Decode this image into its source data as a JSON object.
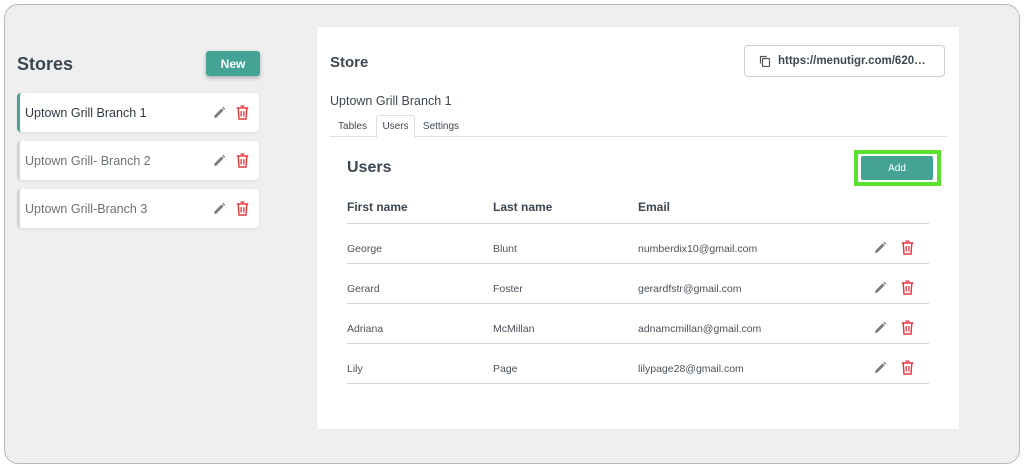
{
  "sidebar": {
    "title": "Stores",
    "new_label": "New",
    "stores": [
      {
        "name": "Uptown Grill Branch 1",
        "active": true
      },
      {
        "name": "Uptown Grill- Branch 2",
        "active": false
      },
      {
        "name": "Uptown Grill-Branch 3",
        "active": false
      }
    ]
  },
  "main": {
    "title": "Store",
    "url": "https://menutigr.com/620…",
    "store_name": "Uptown Grill Branch 1",
    "tabs": [
      {
        "label": "Tables",
        "active": false
      },
      {
        "label": "Users",
        "active": true
      },
      {
        "label": "Settings",
        "active": false
      }
    ],
    "users": {
      "title": "Users",
      "add_label": "Add",
      "columns": [
        "First name",
        "Last name",
        "Email"
      ],
      "rows": [
        {
          "first": "George",
          "last": "Blunt",
          "email": "numberdix10@gmail.com"
        },
        {
          "first": "Gerard",
          "last": "Foster",
          "email": "gerardfstr@gmail.com"
        },
        {
          "first": "Adriana",
          "last": "McMillan",
          "email": "adnamcmillan@gmail.com"
        },
        {
          "first": "Lily",
          "last": "Page",
          "email": "lilypage28@gmail.com"
        }
      ]
    }
  },
  "colors": {
    "accent": "#44a394",
    "delete": "#e0393e",
    "edit": "#7c7c7c",
    "highlight": "#5de12f"
  },
  "icons": {
    "edit": "pencil-icon",
    "delete": "trash-icon",
    "copy": "copy-icon"
  }
}
